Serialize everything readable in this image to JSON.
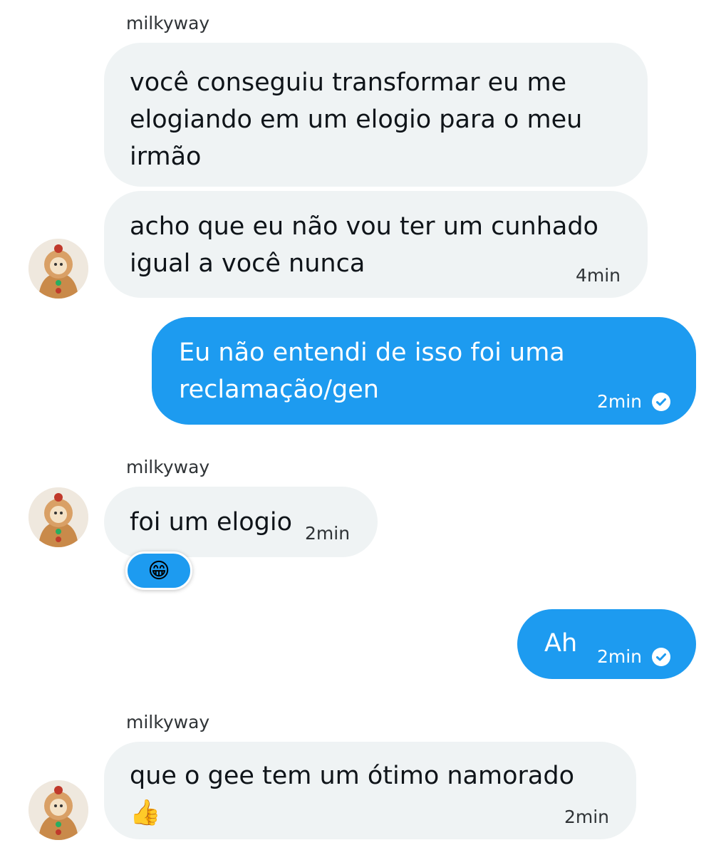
{
  "conversation": {
    "sender_name": "milkyway",
    "messages": [
      {
        "text": "você conseguiu transformar eu me elogiando em um elogio para o meu irmão"
      },
      {
        "text": "acho que eu não vou ter um cunhado igual a você nunca",
        "time": "4min"
      },
      {
        "text": "Eu não entendi de isso foi uma reclamação/gen",
        "time": "2min"
      },
      {
        "text": "foi um elogio",
        "time": "2min",
        "reaction": "😁"
      },
      {
        "text": "Ah",
        "time": "2min"
      },
      {
        "text": "que o gee tem um ótimo namorado 👍",
        "time": "2min"
      }
    ]
  },
  "colors": {
    "incoming_bubble": "#eff3f4",
    "outgoing_bubble": "#1d9bf0",
    "accent": "#1d9bf0"
  },
  "icons": {
    "read_receipt": "check-circle-icon",
    "avatar": "cat-avatar-icon"
  }
}
